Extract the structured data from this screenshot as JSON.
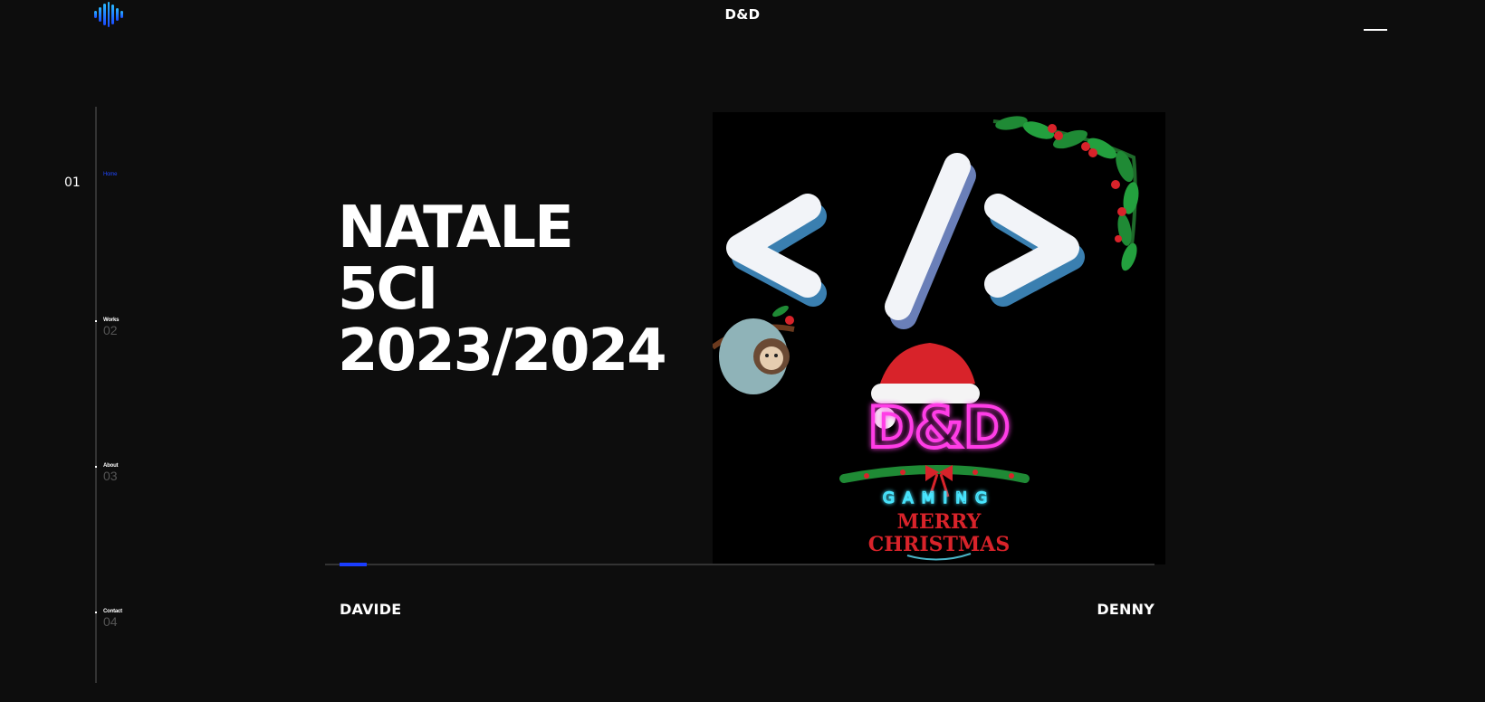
{
  "header": {
    "brand": "D&D",
    "logo_icon": "soundwave-logo-icon",
    "menu_icon": "hamburger-menu-icon"
  },
  "sidebar": {
    "current_page": "01",
    "items": [
      {
        "label": "Home",
        "num": ""
      },
      {
        "label": "Works",
        "num": "02"
      },
      {
        "label": "About",
        "num": "03"
      },
      {
        "label": "Contact",
        "num": "04"
      }
    ]
  },
  "hero": {
    "title_lines": [
      "NATALE",
      "5CI",
      "2023/2024"
    ]
  },
  "artwork": {
    "code_symbol": "</>",
    "logo_text": "D&D",
    "gaming_text": "GAMING",
    "merry_text": "MERRY",
    "christmas_text": "CHRISTMAS"
  },
  "slider": {
    "progress": 0.03,
    "left_name": "DAVIDE",
    "right_name": "DENNY"
  },
  "colors": {
    "background": "#0d0d0d",
    "accent": "#1a3dff",
    "neon_pink": "#ff3ce6",
    "neon_cyan": "#49e6ff",
    "christmas_red": "#d8232a"
  }
}
